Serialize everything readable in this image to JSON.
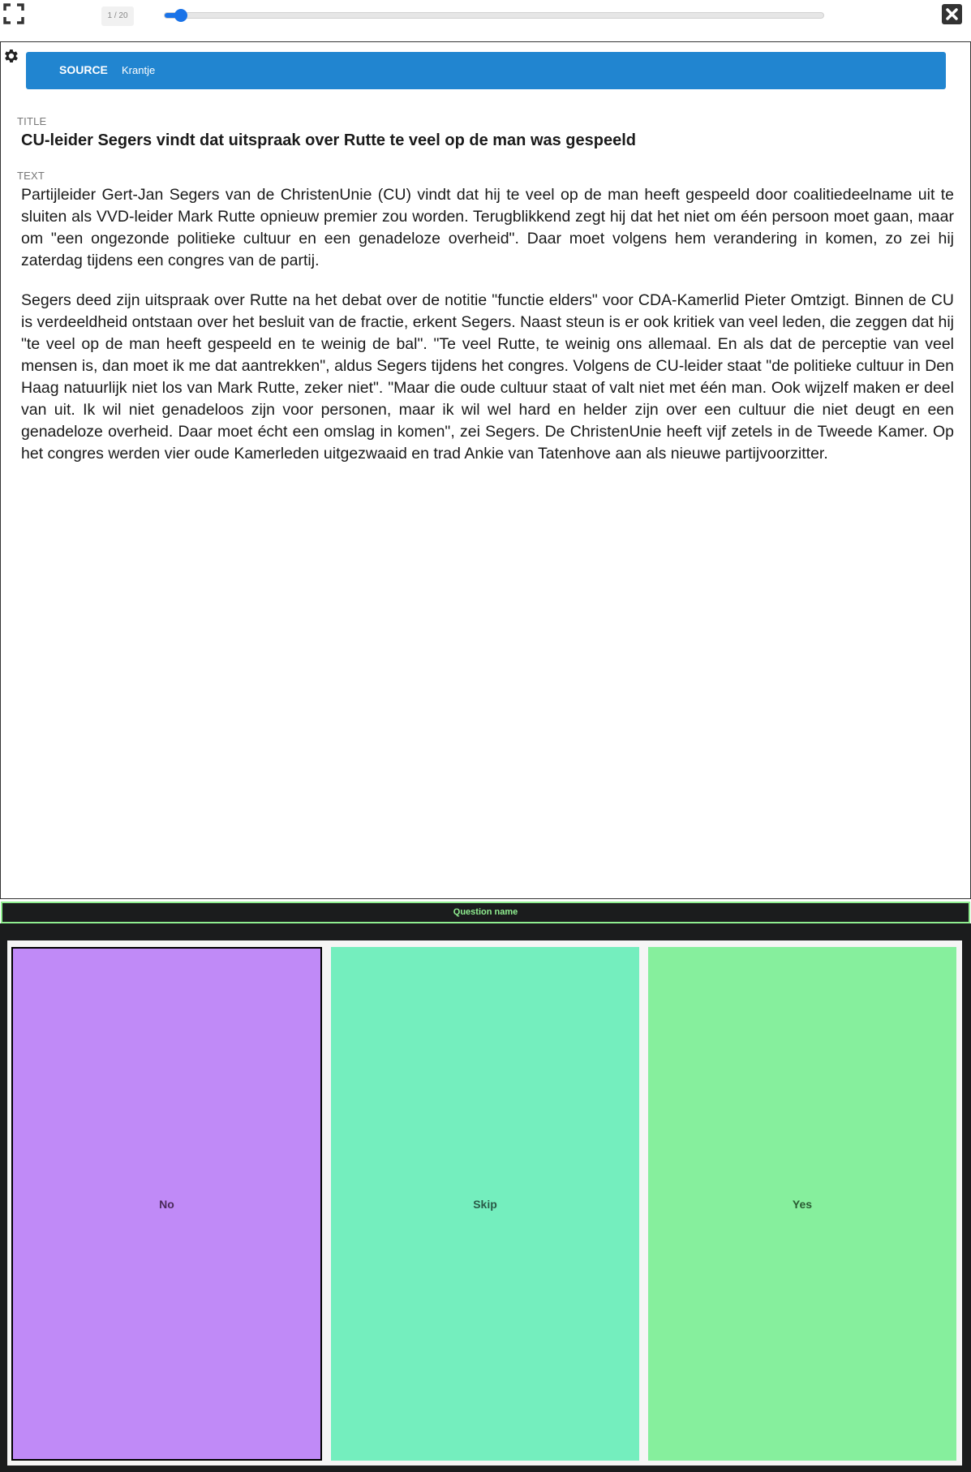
{
  "topbar": {
    "counter": "1 / 20",
    "progress": 0.025,
    "fullscreen_icon": "fullscreen-icon",
    "close_icon": "close-icon"
  },
  "source": {
    "label": "SOURCE",
    "value": "Krantje"
  },
  "fields": {
    "title_label": "TITLE",
    "title": "CU-leider Segers vindt dat uitspraak over Rutte te veel op de man was gespeeld",
    "text_label": "TEXT",
    "paragraphs": [
      "Partijleider Gert-Jan Segers van de ChristenUnie (CU) vindt dat hij te veel op de man heeft gespeeld door coalitiedeelname uit te sluiten als VVD-leider Mark Rutte opnieuw premier zou worden. Terugblikkend zegt hij dat het niet om één persoon moet gaan, maar om \"een ongezonde politieke cultuur en een genadeloze overheid\". Daar moet volgens hem verandering in komen, zo zei hij zaterdag tijdens een congres van de partij.",
      "Segers deed zijn uitspraak over Rutte na het debat over de notitie \"functie elders\" voor CDA-Kamerlid Pieter Omtzigt. Binnen de CU is verdeeldheid ontstaan over het besluit van de fractie, erkent Segers. Naast steun is er ook kritiek van veel leden, die zeggen dat hij \"te veel op de man heeft gespeeld en te weinig de bal\". \"Te veel Rutte, te weinig ons allemaal. En als dat de perceptie van veel mensen is, dan moet ik me dat aantrekken\", aldus Segers tijdens het congres. Volgens de CU-leider staat \"de politieke cultuur in Den Haag natuurlijk niet los van Mark Rutte, zeker niet\". \"Maar die oude cultuur staat of valt niet met één man. Ook wijzelf maken er deel van uit. Ik wil niet genadeloos zijn voor personen, maar ik wil wel hard en helder zijn over een cultuur die niet deugt en een genadeloze overheid. Daar moet écht een omslag in komen\", zei Segers. De ChristenUnie heeft vijf zetels in de Tweede Kamer. Op het congres werden vier oude Kamerleden uitgezwaaid en trad Ankie van Tatenhove aan als nieuwe partijvoorzitter."
    ]
  },
  "question": {
    "name": "Question name"
  },
  "answers": {
    "no": "No",
    "skip": "Skip",
    "yes": "Yes"
  },
  "colors": {
    "source_bar": "#2185d0",
    "no": "#c08af7",
    "skip": "#74eebe",
    "yes": "#86ef9d",
    "question_accent": "#90ee90"
  }
}
